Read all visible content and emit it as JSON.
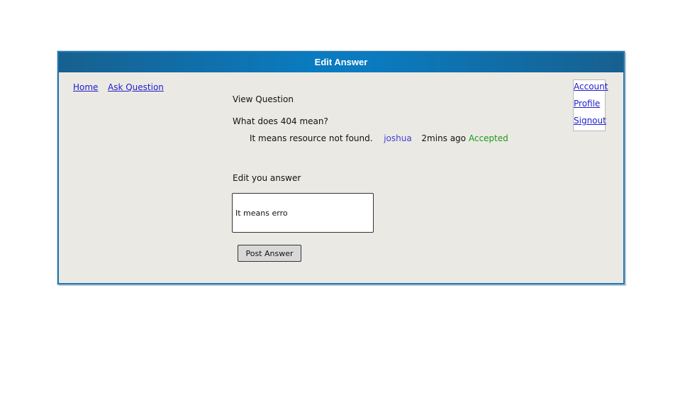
{
  "window": {
    "title": "Edit Answer"
  },
  "nav": {
    "home": "Home",
    "ask_question": "Ask Question"
  },
  "account_menu": {
    "account": "Account",
    "profile": "Profile",
    "signout": "Signout"
  },
  "main": {
    "view_question": "View Question",
    "question": "What does 404 mean?",
    "answer": {
      "text": "It means resource not found.",
      "user": "joshua",
      "time": "2mins ago",
      "status": "Accepted"
    },
    "edit_label": "Edit you answer",
    "edit_value": "It means erro",
    "post_button": "Post Answer"
  },
  "colors": {
    "titlebar": "#0a7bc0",
    "background": "#ebe9e3",
    "link": "#1d1dcc",
    "user": "#4040d6",
    "accepted": "#1a9a1a"
  }
}
